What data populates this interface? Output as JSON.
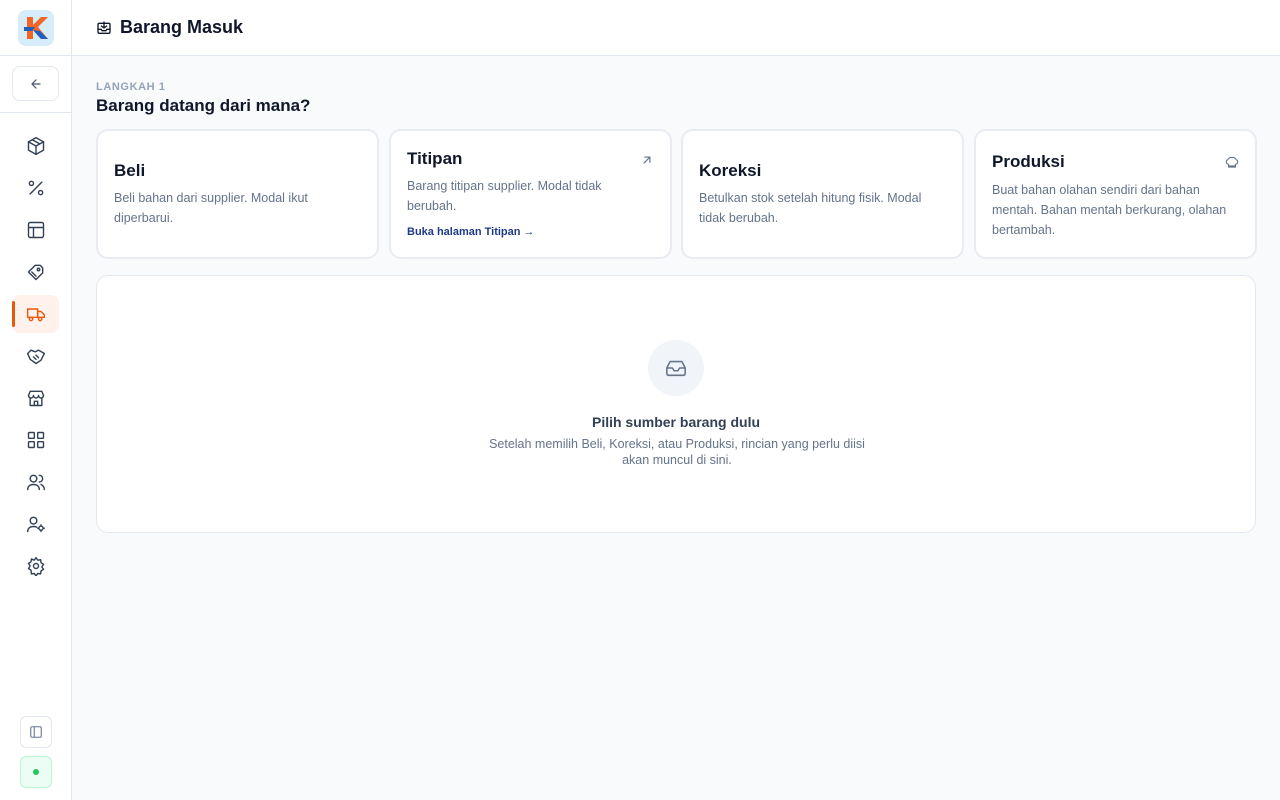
{
  "app": {
    "logo_letter": "K"
  },
  "sidebar": {
    "items": [
      {
        "name": "products",
        "icon": "package-icon",
        "active": false
      },
      {
        "name": "discounts",
        "icon": "percent-icon",
        "active": false
      },
      {
        "name": "layout",
        "icon": "layout-icon",
        "active": false
      },
      {
        "name": "ingredients",
        "icon": "tag-icon",
        "active": false
      },
      {
        "name": "incoming-goods",
        "icon": "truck-icon",
        "active": true
      },
      {
        "name": "consignment",
        "icon": "handshake-icon",
        "active": false
      },
      {
        "name": "store",
        "icon": "store-icon",
        "active": false
      },
      {
        "name": "apps",
        "icon": "grid-icon",
        "active": false
      },
      {
        "name": "customers",
        "icon": "users-icon",
        "active": false
      },
      {
        "name": "staff",
        "icon": "user-cog-icon",
        "active": false
      },
      {
        "name": "settings",
        "icon": "gear-icon",
        "active": false
      }
    ]
  },
  "header": {
    "title": "Barang Masuk"
  },
  "step": {
    "label": "LANGKAH 1",
    "heading": "Barang datang dari mana?"
  },
  "sources": [
    {
      "title": "Beli",
      "description": "Beli bahan dari supplier. Modal ikut diperbarui."
    },
    {
      "title": "Titipan",
      "description": "Barang titipan supplier. Modal tidak berubah.",
      "link": "Buka halaman Titipan →"
    },
    {
      "title": "Koreksi",
      "description": "Betulkan stok setelah hitung fisik. Modal tidak berubah."
    },
    {
      "title": "Produksi",
      "description": "Buat bahan olahan sendiri dari bahan mentah. Bahan mentah berkurang, olahan bertambah."
    }
  ],
  "empty_state": {
    "title": "Pilih sumber barang dulu",
    "description": "Setelah memilih Beli, Koreksi, atau Produksi, rincian yang perlu diisi akan muncul di sini."
  },
  "colors": {
    "accent": "#ea580c",
    "link": "#1e3a8a",
    "status": "#22c55e"
  }
}
